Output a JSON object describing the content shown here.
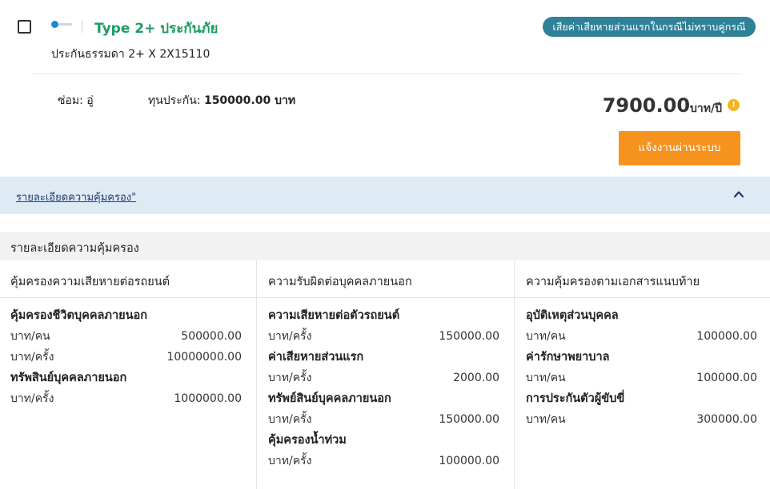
{
  "header": {
    "plan_title": "Type 2+ ประกันภัย",
    "plan_subtitle": "ประกันธรรมดา 2+ X 2X15110",
    "badge": "เสียค่าเสียหายส่วนแรกในกรณีไม่ทราบคู่กรณี"
  },
  "summary": {
    "repair": "ซ่อม: อู่",
    "sum_label": "ทุนประกัน:",
    "sum_value": "150000.00 บาท",
    "price": "7900.00",
    "price_unit": "บาท/ปี",
    "info_glyph": "!",
    "notify_button": "แจ้งงานผ่านระบบ"
  },
  "detail_toggle": {
    "label": "รายละเอียดความคุ้มครอง\"",
    "icon": "chevron-up-icon"
  },
  "coverage": {
    "section_title": "รายละเอียดความคุ้มครอง",
    "columns": [
      {
        "header": "คุ้มครองความเสียหายต่อรถยนต์",
        "rows": [
          {
            "type": "title",
            "text": "คุ้มครองชีวิตบุคคลภายนอก"
          },
          {
            "type": "value",
            "label": "บาท/คน",
            "value": "500000.00"
          },
          {
            "type": "value",
            "label": "บาท/ครั้ง",
            "value": "10000000.00"
          },
          {
            "type": "title",
            "text": "ทรัพสินย์บุคคลภายนอก"
          },
          {
            "type": "value",
            "label": "บาท/ครั้ง",
            "value": "1000000.00"
          }
        ]
      },
      {
        "header": "ความรับผิดต่อบุคคลภายนอก",
        "rows": [
          {
            "type": "title",
            "text": "ความเสียหายต่อตัวรถยนต์"
          },
          {
            "type": "value",
            "label": "บาท/ครั้ง",
            "value": "150000.00"
          },
          {
            "type": "title",
            "text": "ค่าเสียหายส่วนแรก"
          },
          {
            "type": "value",
            "label": "บาท/ครั้ง",
            "value": "2000.00"
          },
          {
            "type": "title",
            "text": "ทรัพย์สินย์บุคคลภายนอก"
          },
          {
            "type": "value",
            "label": "บาท/ครั้ง",
            "value": "150000.00"
          },
          {
            "type": "title",
            "text": "คุ้มครองน้ำท่วม"
          },
          {
            "type": "value",
            "label": "บาท/ครั้ง",
            "value": "100000.00"
          }
        ]
      },
      {
        "header": "ความคุ้มครองตามเอกสารแนบท้าย",
        "rows": [
          {
            "type": "title",
            "text": "อุบัติเหตุส่วนบุคคล"
          },
          {
            "type": "value",
            "label": "บาท/คน",
            "value": "100000.00"
          },
          {
            "type": "title",
            "text": "ค่ารักษาพยาบาล"
          },
          {
            "type": "value",
            "label": "บาท/คน",
            "value": "100000.00"
          },
          {
            "type": "title",
            "text": "การประกันตัวผู้ขับขี่"
          },
          {
            "type": "value",
            "label": "บาท/คน",
            "value": "300000.00"
          }
        ]
      }
    ]
  }
}
